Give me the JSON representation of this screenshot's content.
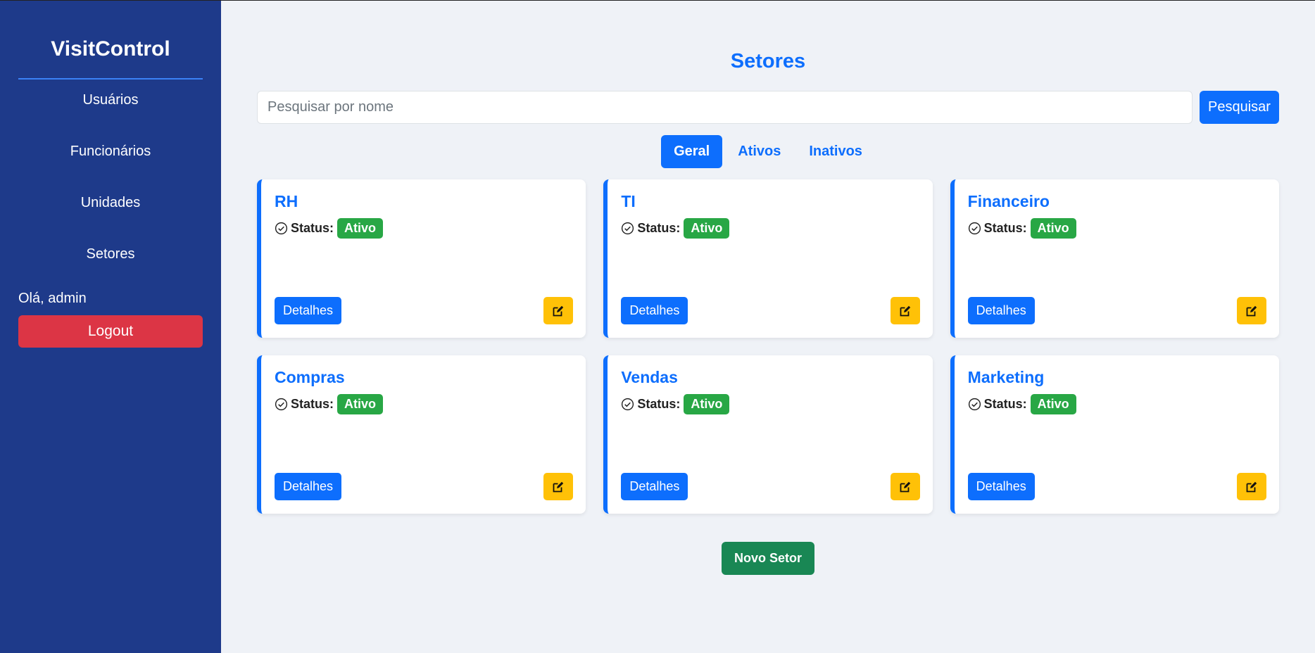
{
  "sidebar": {
    "brand": "VisitControl",
    "nav": [
      {
        "label": "Usuários"
      },
      {
        "label": "Funcionários"
      },
      {
        "label": "Unidades"
      },
      {
        "label": "Setores"
      }
    ],
    "greeting": "Olá, admin",
    "logout_label": "Logout"
  },
  "main": {
    "title": "Setores",
    "search": {
      "placeholder": "Pesquisar por nome",
      "value": "",
      "button_label": "Pesquisar"
    },
    "tabs": [
      {
        "label": "Geral",
        "active": true
      },
      {
        "label": "Ativos",
        "active": false
      },
      {
        "label": "Inativos",
        "active": false
      }
    ],
    "status_label": "Status:",
    "details_label": "Detalhes",
    "cards": [
      {
        "name": "RH",
        "status": "Ativo"
      },
      {
        "name": "TI",
        "status": "Ativo"
      },
      {
        "name": "Financeiro",
        "status": "Ativo"
      },
      {
        "name": "Compras",
        "status": "Ativo"
      },
      {
        "name": "Vendas",
        "status": "Ativo"
      },
      {
        "name": "Marketing",
        "status": "Ativo"
      }
    ],
    "new_button_label": "Novo Setor"
  },
  "icons": {
    "status": "check-circle-icon",
    "edit": "edit-icon"
  },
  "colors": {
    "sidebar_bg": "#1e3a8a",
    "primary": "#0d6efd",
    "success_badge": "#28a745",
    "danger": "#dc3545",
    "warning": "#ffc107",
    "new_button": "#198754"
  }
}
